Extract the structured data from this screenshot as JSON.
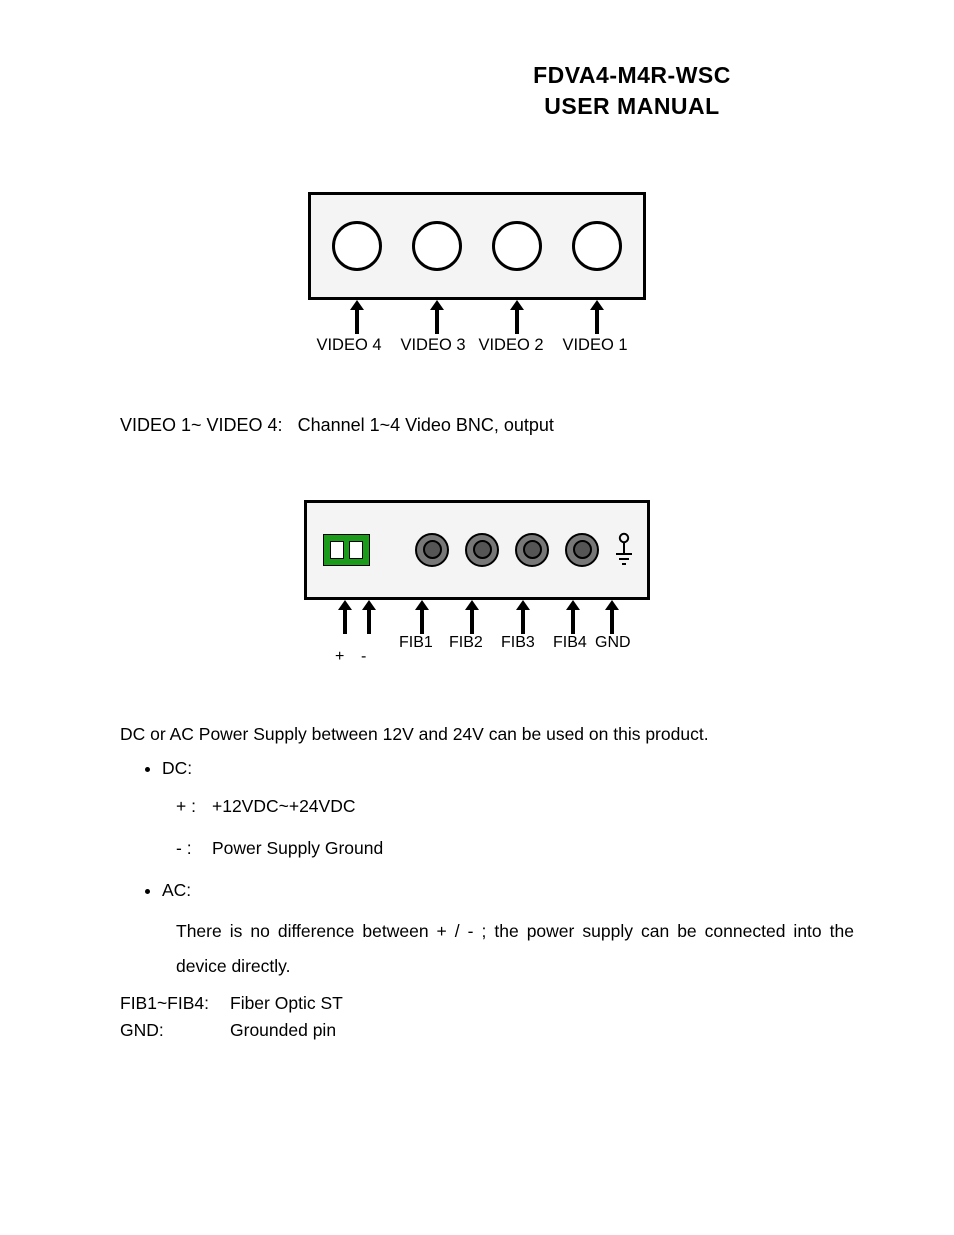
{
  "header": {
    "line1": "FDVA4-M4R-WSC",
    "line2": "USER MANUAL"
  },
  "video_panel": {
    "labels": [
      "VIDEO 4",
      "VIDEO 3",
      "VIDEO 2",
      "VIDEO 1"
    ]
  },
  "video_desc": {
    "key": "VIDEO 1~ VIDEO 4:",
    "value": "Channel 1~4 Video BNC, output"
  },
  "fib_panel": {
    "power_pos": "+",
    "power_neg": "-",
    "labels": [
      "FIB1",
      "FIB2",
      "FIB3",
      "FIB4",
      "GND"
    ]
  },
  "power_intro": "DC or AC Power Supply between 12V and 24V can be used on this product.",
  "dc": {
    "title": "DC:",
    "pos_sym": "+ :",
    "pos_text": "+12VDC~+24VDC",
    "neg_sym": "- :",
    "neg_text": "Power Supply Ground"
  },
  "ac": {
    "title": "AC:",
    "text": "There is no difference between  + / - ; the power supply can be connected into the device directly."
  },
  "defs": {
    "fib_key": "FIB1~FIB4:",
    "fib_val": "Fiber Optic ST",
    "gnd_key": "GND:",
    "gnd_val": "Grounded pin"
  }
}
